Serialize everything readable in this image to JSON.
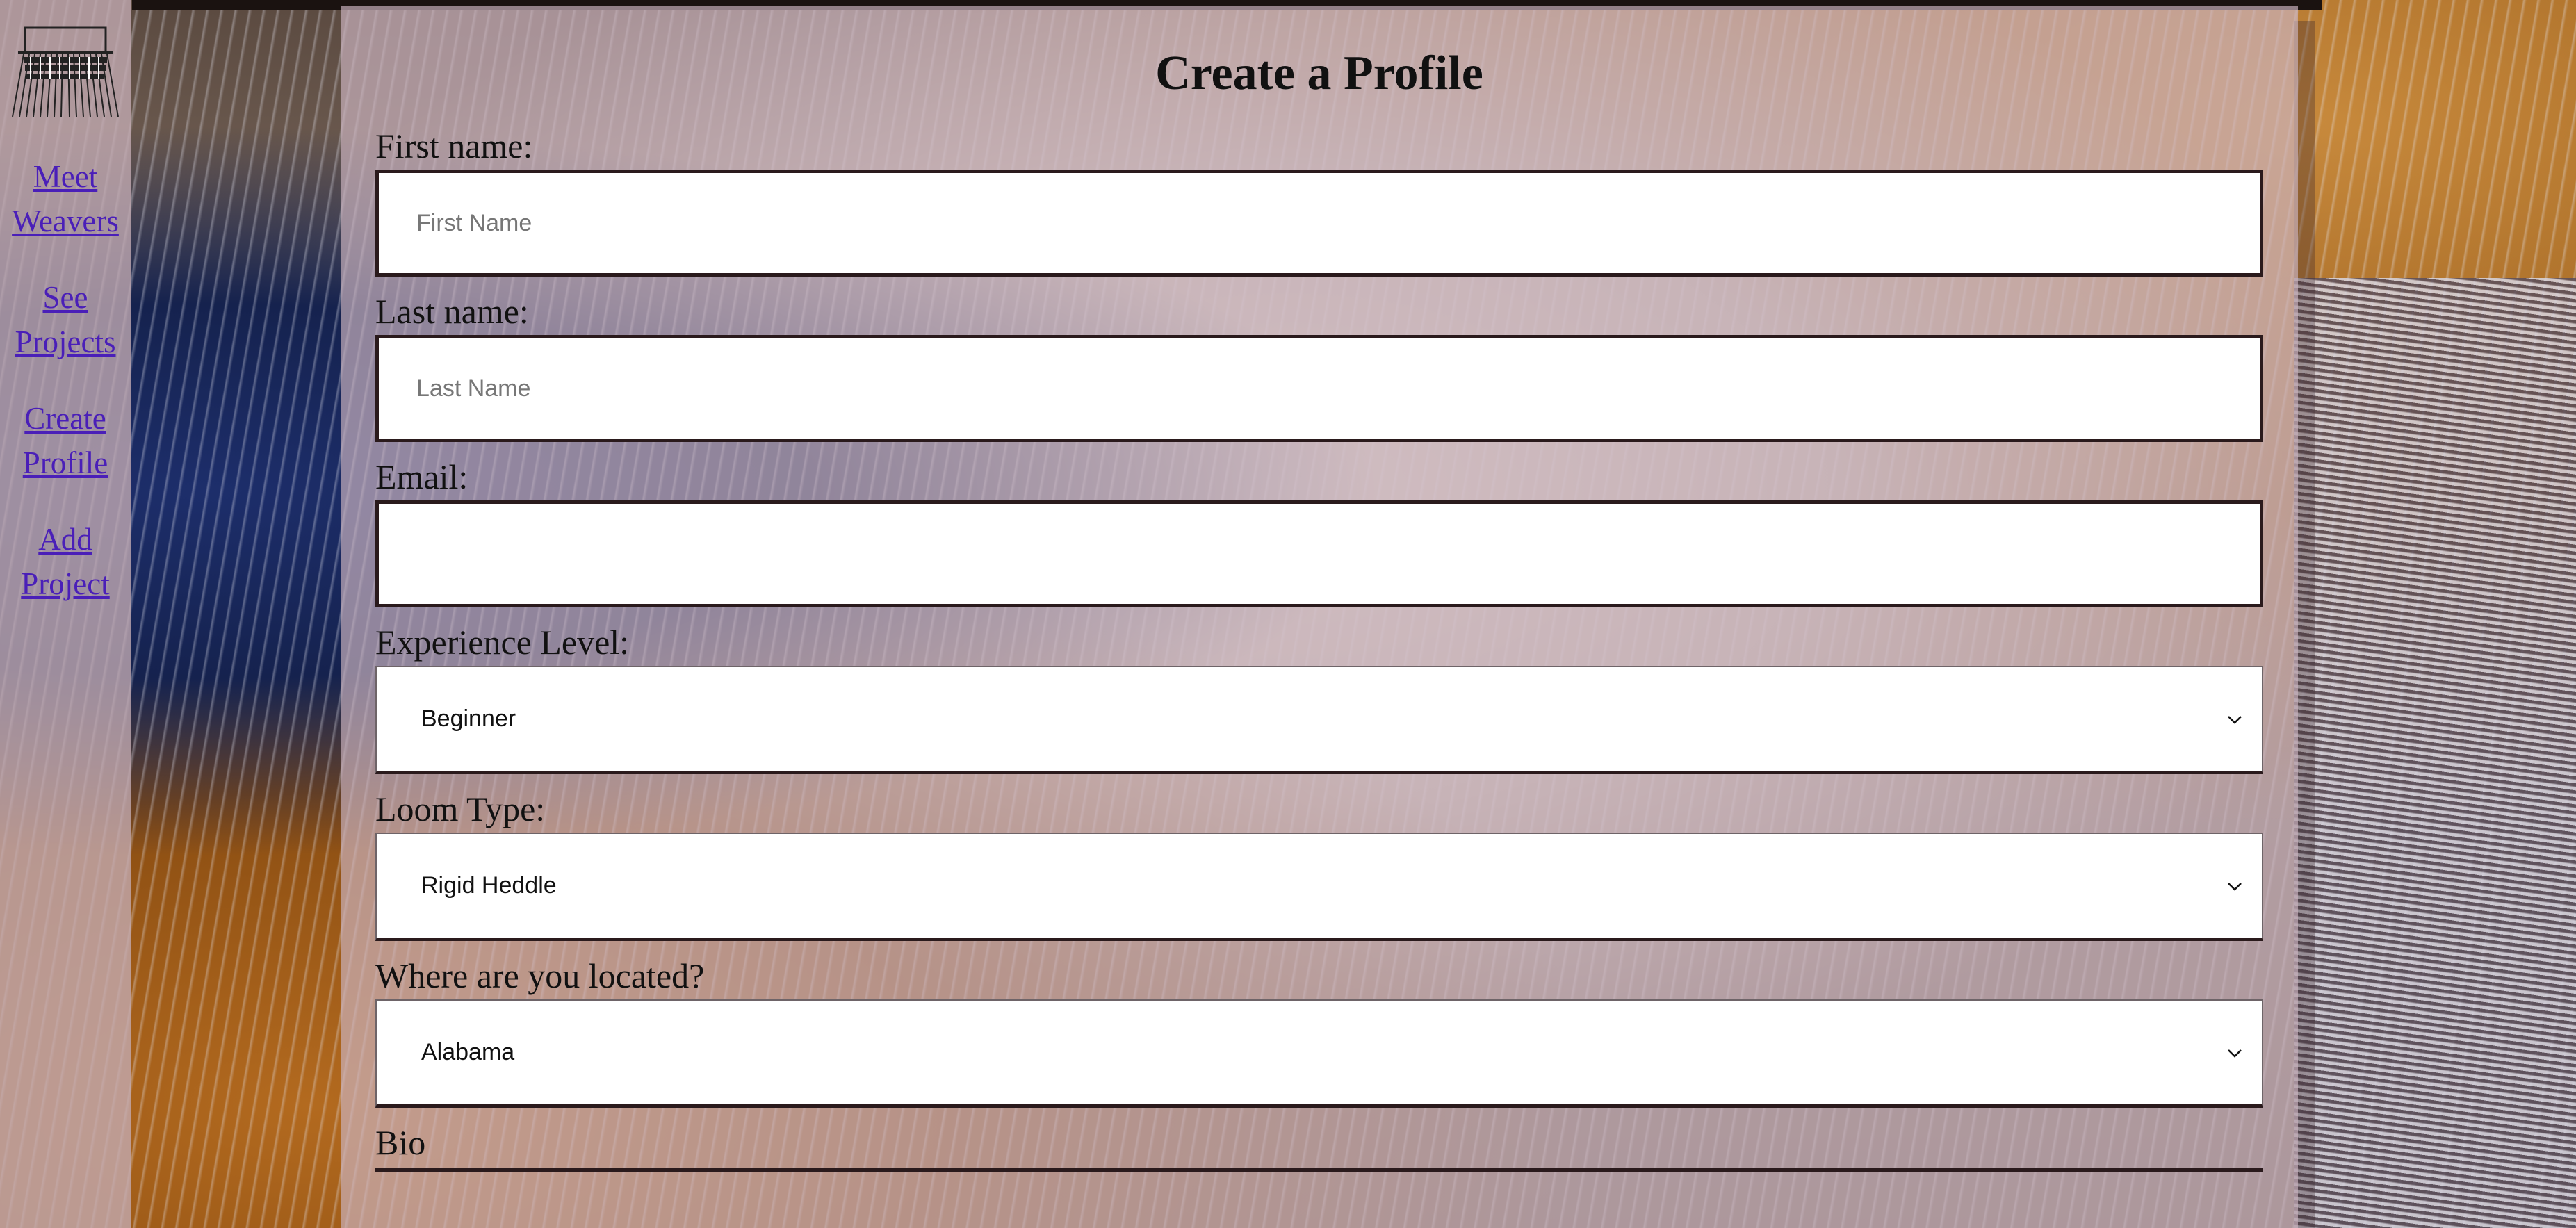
{
  "nav": {
    "items": [
      {
        "label_line1": "Meet",
        "label_line2": "Weavers"
      },
      {
        "label_line1": "See",
        "label_line2": "Projects"
      },
      {
        "label_line1": "Create",
        "label_line2": "Profile"
      },
      {
        "label_line1": "Add",
        "label_line2": "Project"
      }
    ],
    "logo_icon": "loom-icon",
    "link_color": "#4a1fb8"
  },
  "form": {
    "title": "Create a Profile",
    "first_name": {
      "label": "First name:",
      "placeholder": "First Name",
      "value": ""
    },
    "last_name": {
      "label": "Last name:",
      "placeholder": "Last Name",
      "value": ""
    },
    "email": {
      "label": "Email:",
      "placeholder": "",
      "value": ""
    },
    "experience": {
      "label": "Experience Level:",
      "selected": "Beginner",
      "icon": "chevron-down-icon"
    },
    "loom_type": {
      "label": "Loom Type:",
      "selected": "Rigid Heddle",
      "icon": "chevron-down-icon"
    },
    "location": {
      "label": "Where are you located?",
      "selected": "Alabama",
      "icon": "chevron-down-icon"
    },
    "bio": {
      "label": "Bio"
    }
  }
}
